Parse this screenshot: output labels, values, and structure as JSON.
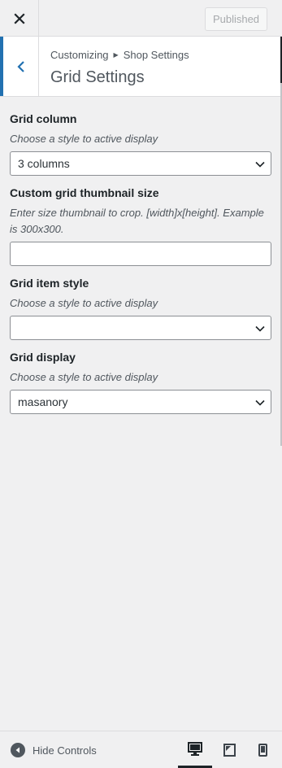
{
  "topbar": {
    "publish_label": "Published"
  },
  "section": {
    "breadcrumb_parent": "Customizing",
    "breadcrumb_current": "Shop Settings",
    "title": "Grid Settings"
  },
  "controls": {
    "grid_column": {
      "title": "Grid column",
      "description": "Choose a style to active display",
      "selected": "3 columns"
    },
    "thumbnail_size": {
      "title": "Custom grid thumbnail size",
      "description": "Enter size thumbnail to crop. [width]x[height]. Example is 300x300.",
      "value": ""
    },
    "grid_item_style": {
      "title": "Grid item style",
      "description": "Choose a style to active display",
      "selected": ""
    },
    "grid_display": {
      "title": "Grid display",
      "description": "Choose a style to active display",
      "selected": "masanory"
    }
  },
  "footer": {
    "hide_controls_label": "Hide Controls",
    "devices": [
      "desktop",
      "tablet",
      "mobile"
    ],
    "active_device": "desktop"
  },
  "colors": {
    "accent": "#2271b1",
    "background": "#f0f0f1",
    "text": "#1d2327"
  }
}
